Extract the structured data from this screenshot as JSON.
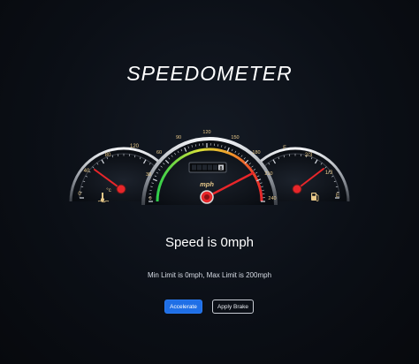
{
  "title": "SPEEDOMETER",
  "speed_text": "Speed is 0mph",
  "limits_text": "Min Limit is 0mph, Max Limit is 200mph",
  "buttons": {
    "accelerate": "Accelerate",
    "brake": "Apply Brake"
  },
  "gauges": {
    "temperature": {
      "ticks": [
        "0",
        "40",
        "80",
        "120"
      ],
      "unit": "°c"
    },
    "speed": {
      "ticks": [
        "0",
        "30",
        "60",
        "90",
        "120",
        "150",
        "180",
        "210",
        "240"
      ],
      "unit": "mph",
      "odometer": "8",
      "needle_value": 225
    },
    "fuel": {
      "ticks": [
        "E",
        "1/3",
        "2/3",
        "F"
      ]
    }
  },
  "colors": {
    "accent": "#1f6fe6",
    "needle": "#e8262a",
    "tick_text": "#e8c98a"
  }
}
